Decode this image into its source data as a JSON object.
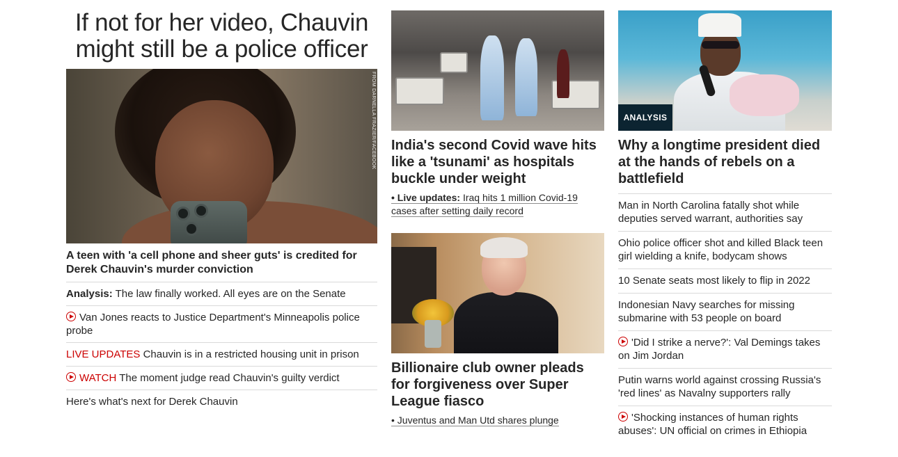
{
  "lead": {
    "headline": "If not for her video, Chauvin might still be a police officer",
    "image_credit": "FROM DARNELLA FRAZIER/FACEBOOK",
    "caption": "A teen with 'a cell phone and sheer guts' is credited for Derek Chauvin's murder conviction",
    "links": [
      {
        "prefix": "Analysis:",
        "text": "The law finally worked. All eyes are on the Senate"
      },
      {
        "icon": "play-icon",
        "text": "Van Jones reacts to Justice Department's Minneapolis police probe"
      },
      {
        "prefix": "LIVE UPDATES",
        "text": "Chauvin is in a restricted housing unit in prison"
      },
      {
        "icon": "play-icon",
        "prefix": "WATCH",
        "text": "The moment judge read Chauvin's guilty verdict"
      },
      {
        "text": "Here's what's next for Derek Chauvin"
      }
    ]
  },
  "india": {
    "headline": "India's second Covid wave hits like a 'tsunami' as hospitals buckle under weight",
    "sub_prefix": "• Live updates:",
    "sub_text": "Iraq hits 1 million Covid-19 cases after setting daily record"
  },
  "club": {
    "headline": "Billionaire club owner pleads for forgiveness over Super League fiasco",
    "sub_text": "• Juventus and Man Utd shares plunge"
  },
  "chad": {
    "tag": "ANALYSIS",
    "headline": "Why a longtime president died at the hands of rebels on a battlefield",
    "links": [
      {
        "text": "Man in North Carolina fatally shot while deputies served warrant, authorities say"
      },
      {
        "text": "Ohio police officer shot and killed Black teen girl wielding a knife, bodycam shows"
      },
      {
        "text": "10 Senate seats most likely to flip in 2022"
      },
      {
        "text": "Indonesian Navy searches for missing submarine with 53 people on board"
      },
      {
        "icon": "play-icon",
        "text": "'Did I strike a nerve?': Val Demings takes on Jim Jordan"
      },
      {
        "text": "Putin warns world against crossing Russia's 'red lines' as Navalny supporters rally"
      },
      {
        "icon": "play-icon",
        "text": "'Shocking instances of human rights abuses': UN official on crimes in Ethiopia"
      }
    ]
  },
  "colors": {
    "text": "#262626",
    "accent_red": "#cc0000",
    "tag_bg": "#0c2431",
    "divider": "#d9d9d9"
  }
}
